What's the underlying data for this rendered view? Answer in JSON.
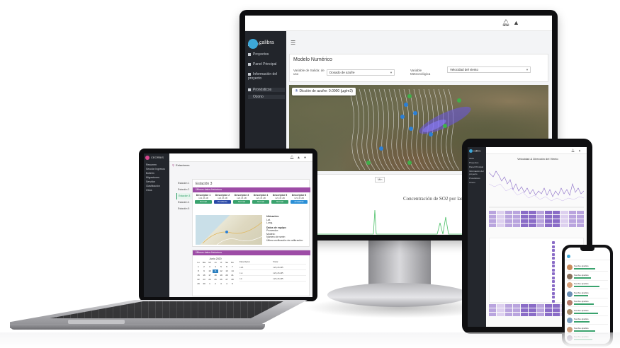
{
  "monitor": {
    "brand": "calibra",
    "sidebar_items": [
      "Inicio",
      "Proyectos",
      "Panel Principal",
      "Información del proyecto",
      "Pronósticos",
      "Ozono"
    ],
    "page_title": "Modelo Numérico",
    "variable_label": "Variable de Salida: de uso",
    "variable_value": "Dosado de azufre",
    "met_label": "Variable Meteorológica",
    "met_value": "Velocidad del viento",
    "map_chip": "Dicción de azufre: 0.0000 (µg/m3)",
    "lower_chip_1": "Datos",
    "lower_chip_2": "Min",
    "chart_title": "Concentración de SO2 por las próximas 72 horas"
  },
  "laptop": {
    "brand": "CEORBIS",
    "sidebar_items": [
      "Resumen",
      "Sección Ingresos",
      "Bolletín",
      "Migraciones",
      "Servidor",
      "Clasificación",
      "Otros"
    ],
    "breadcrumb": "Estaciones",
    "stations": [
      "Estación 1",
      "Estación 2",
      "Estación 3",
      "Estación 4",
      "Estación 5"
    ],
    "active_station": "Estación 3",
    "panel_title": "Estación 3",
    "band_1": "Últimos datos historicos",
    "columns": [
      {
        "head": "Descriptor 1",
        "value": "123,45 dB",
        "button": "Normal",
        "color": "#3aa36e"
      },
      {
        "head": "Descriptor 2",
        "value": "123,45 dB",
        "button": "Pendiente",
        "color": "#2b4aa8"
      },
      {
        "head": "Descriptor 3",
        "value": "123,45 dB",
        "button": "Normal",
        "color": "#3aa36e"
      },
      {
        "head": "Descriptor 4",
        "value": "123,45 dB",
        "button": "Normal",
        "color": "#3aa36e"
      },
      {
        "head": "Descriptor 5",
        "value": "123,45 dB",
        "button": "Normal",
        "color": "#3aa36e"
      },
      {
        "head": "Descriptor 6",
        "value": "123,45 dB",
        "button": "Actualizar",
        "color": "#2b8fd6"
      }
    ],
    "info": {
      "ubicacion": "Ubicación:",
      "lat": "Lat.",
      "long": "Long.",
      "datos": "Datos de equipo:",
      "l1": "Proveedor:",
      "l2": "Modelo:",
      "l3": "Número de serie:",
      "l4": "Última verificación de calibración:"
    },
    "band_2": "Últimos datos historicos",
    "calendar": {
      "header": "Junio 2020",
      "weekdays": [
        "Lu",
        "Ma",
        "Mi",
        "Ju",
        "Vi",
        "Sa",
        "Do"
      ],
      "days": [
        "1",
        "2",
        "3",
        "4",
        "5",
        "6",
        "7",
        "8",
        "9",
        "10",
        "11",
        "12",
        "13",
        "14",
        "15",
        "16",
        "17",
        "18",
        "19",
        "20",
        "21",
        "22",
        "23",
        "24",
        "25",
        "26",
        "27",
        "28",
        "29",
        "30",
        "1",
        "2",
        "3",
        "4",
        "5"
      ],
      "selected": "11"
    },
    "table": {
      "headers": [
        "Descriptor",
        "Valor"
      ],
      "rows": [
        [
          "123",
          "123,45 dB"
        ],
        [
          "1.4",
          "123,45 dB"
        ],
        [
          "14",
          "123,45 dB"
        ]
      ]
    }
  },
  "tablet": {
    "brand": "calibra",
    "sidebar_items": [
      "Inicio",
      "Proyectos",
      "Panel Principal",
      "Información del proyecto",
      "Pronósticos",
      "Ozono"
    ],
    "chart_title": "Velocidad & Dirección del Viento"
  },
  "phone": {
    "items": [
      "Nombre Apellido",
      "Nombre Apellido",
      "Nombre Apellido",
      "Nombre Apellido",
      "Nombre Apellido",
      "Nombre Apellido",
      "Nombre Apellido",
      "Nombre Apellido",
      "Nombre Apellido"
    ]
  },
  "colors": {
    "accent_purple": "#9d4ca6",
    "map_accent": "#5b5bd6",
    "station_green": "#3aa36e"
  }
}
